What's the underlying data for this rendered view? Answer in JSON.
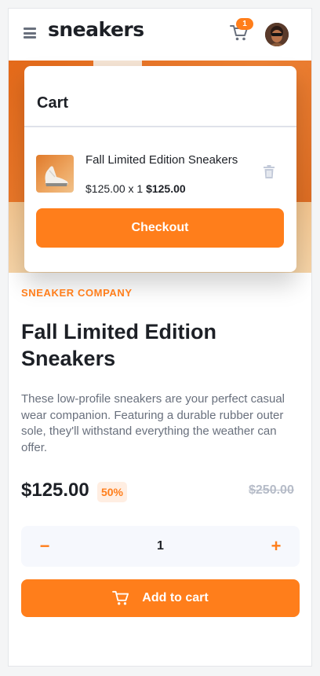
{
  "header": {
    "logo": "sneakers",
    "menu_icon": "hamburger-menu-icon",
    "cart_icon": "cart-icon",
    "cart_count": "1",
    "avatar": "user-avatar"
  },
  "cart": {
    "title": "Cart",
    "item": {
      "name": "Fall Limited Edition Sneakers",
      "unit_line": "$125.00 x 1",
      "total": "$125.00",
      "delete_icon": "trash-icon"
    },
    "checkout_label": "Checkout"
  },
  "product": {
    "company": "SNEAKER COMPANY",
    "title": "Fall Limited Edition Sneakers",
    "description": "These low-profile sneakers are your perfect casual wear companion. Featuring a durable rubber outer sole, they'll withstand everything the weather can offer.",
    "price": "$125.00",
    "discount": "50%",
    "old_price": "$250.00"
  },
  "quantity": {
    "minus_label": "−",
    "value": "1",
    "plus_label": "+"
  },
  "add_to_cart": {
    "label": "Add to cart",
    "icon": "cart-icon"
  },
  "colors": {
    "accent": "#ff7e1b",
    "accent_pale": "#ffeee2",
    "text_dark": "#1d2026",
    "text_gray": "#69707d",
    "text_light": "#b6bcc8"
  }
}
